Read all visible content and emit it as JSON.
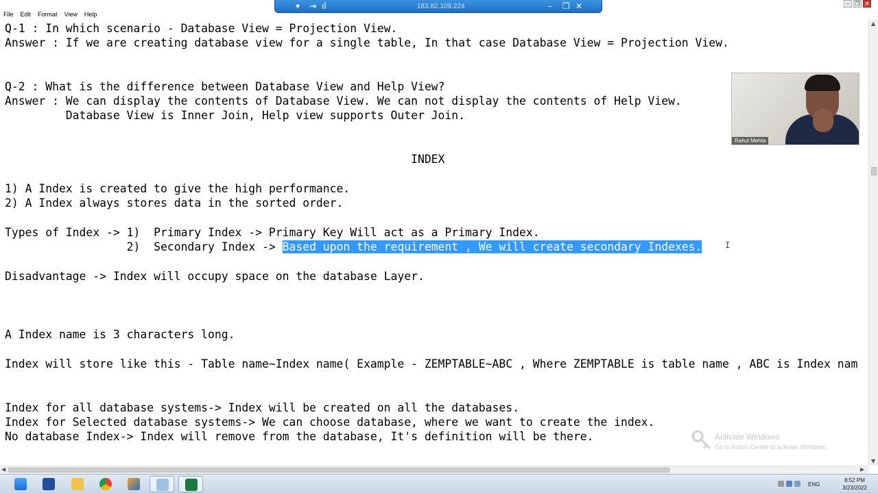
{
  "rdp_bar": {
    "ip": "183.82.109.224"
  },
  "menu": [
    "File",
    "Edit",
    "Format",
    "View",
    "Help"
  ],
  "document": {
    "lines": [
      "Q-1 : In which scenario - Database View = Projection View.",
      "Answer : If we are creating database view for a single table, In that case Database View = Projection View.",
      "",
      "",
      "Q-2 : What is the difference between Database View and Help View?",
      "Answer : We can display the contents of Database View. We can not display the contents of Help View.",
      "         Database View is Inner Join, Help view supports Outer Join.",
      "",
      "                                                            INDEX",
      "",
      "1) A Index is created to give the high performance.",
      "2) A Index always stores data in the sorted order.",
      "",
      "Types of Index -> 1)  Primary Index -> Primary Key Will act as a Primary Index.",
      "                  2)  Secondary Index -> ",
      "",
      "Disadvantage -> Index will occupy space on the database Layer.",
      "",
      "",
      "",
      "A Index name is 3 characters long.",
      "",
      "Index will store like this - Table name~Index name( Example - ZEMPTABLE~ABC , Where ZEMPTABLE is table name , ABC is Index nam",
      "",
      "",
      "Index for all database systems-> Index will be created on all the databases.",
      "Index for Selected database systems-> We can choose database, where we want to create the index.",
      "No database Index-> Index will remove from the database, It's definition will be there."
    ],
    "selected_text": "Based upon the requirement , We will create secondary Indexes."
  },
  "webcam": {
    "name": "Rahul Mehta"
  },
  "watermark": {
    "title": "Activate Windows",
    "subtitle": "Go to Action Center to activate Windows."
  },
  "taskbar": {
    "apps": [
      "start-icon",
      "powershell-icon",
      "file-explorer-icon",
      "chrome-icon",
      "sap-logon-icon",
      "notepad-icon",
      "excel-icon"
    ],
    "tray": {
      "lang": "ENG",
      "time": "8:52 PM",
      "date": "3/23/2022"
    }
  },
  "colors": {
    "selection": "#3399ff",
    "rdp_bar": "#2a7fd4",
    "taskbar": "#d2deeb"
  }
}
